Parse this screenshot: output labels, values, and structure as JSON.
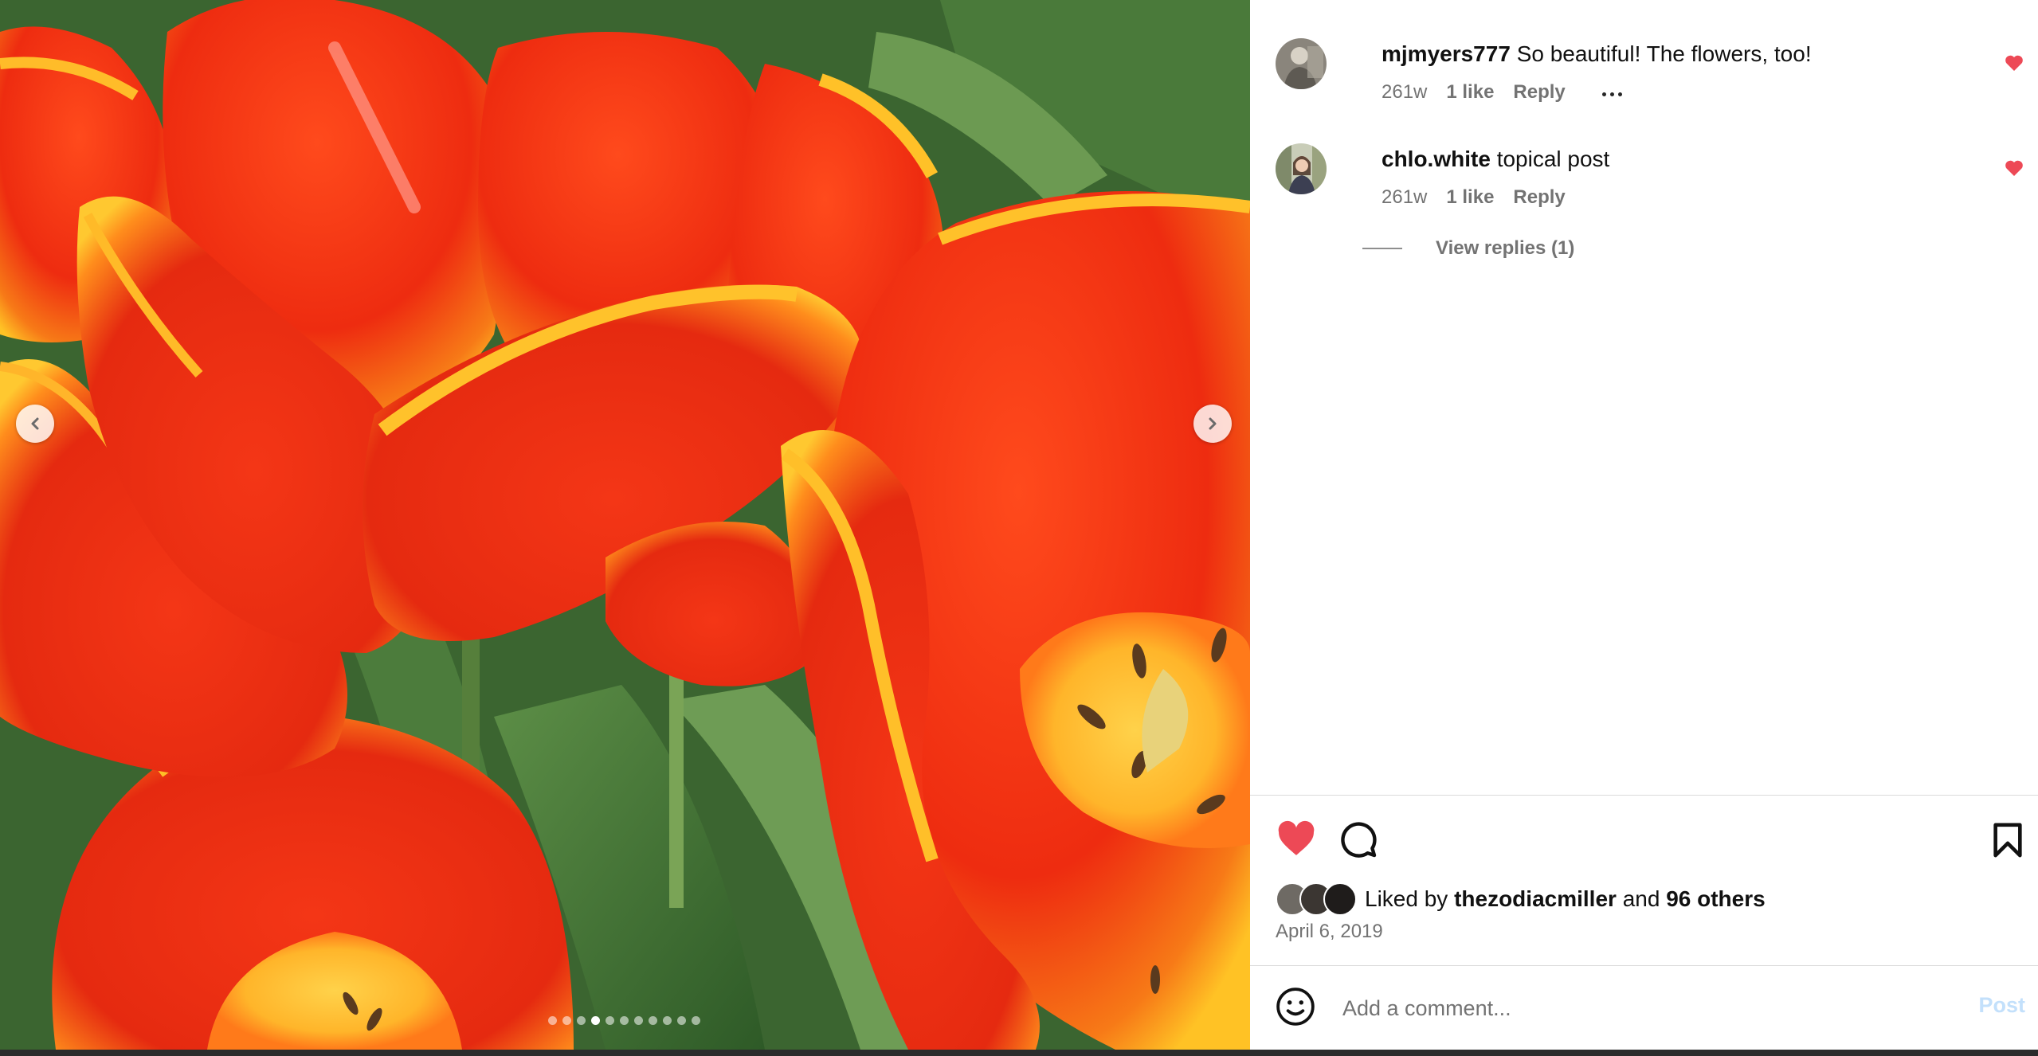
{
  "comments": [
    {
      "username": "mjmyers777",
      "text": "So beautiful! The flowers, too!",
      "age": "261w",
      "likes": "1 like",
      "reply_label": "Reply",
      "avatar": "avatar-photo"
    },
    {
      "username": "chlo.white",
      "text": "topical post",
      "age": "261w",
      "likes": "1 like",
      "reply_label": "Reply",
      "avatar": "avatar-photo"
    }
  ],
  "view_replies_label": "View replies (1)",
  "likes": {
    "prefix": "Liked by",
    "user": "thezodiacmiller",
    "joiner": "and",
    "others": "96 others"
  },
  "post_date": "April 6, 2019",
  "comment_box": {
    "placeholder": "Add a comment...",
    "post_label": "Post"
  },
  "carousel": {
    "slide_count": 11,
    "active_index": 3
  },
  "colors": {
    "heart": "#ed4956",
    "post_disabled": "#c3e0fb",
    "meta": "#737373"
  },
  "icons": [
    "chevron-left-icon",
    "chevron-right-icon",
    "heart-icon",
    "comment-icon",
    "bookmark-icon",
    "emoji-icon",
    "more-icon"
  ]
}
